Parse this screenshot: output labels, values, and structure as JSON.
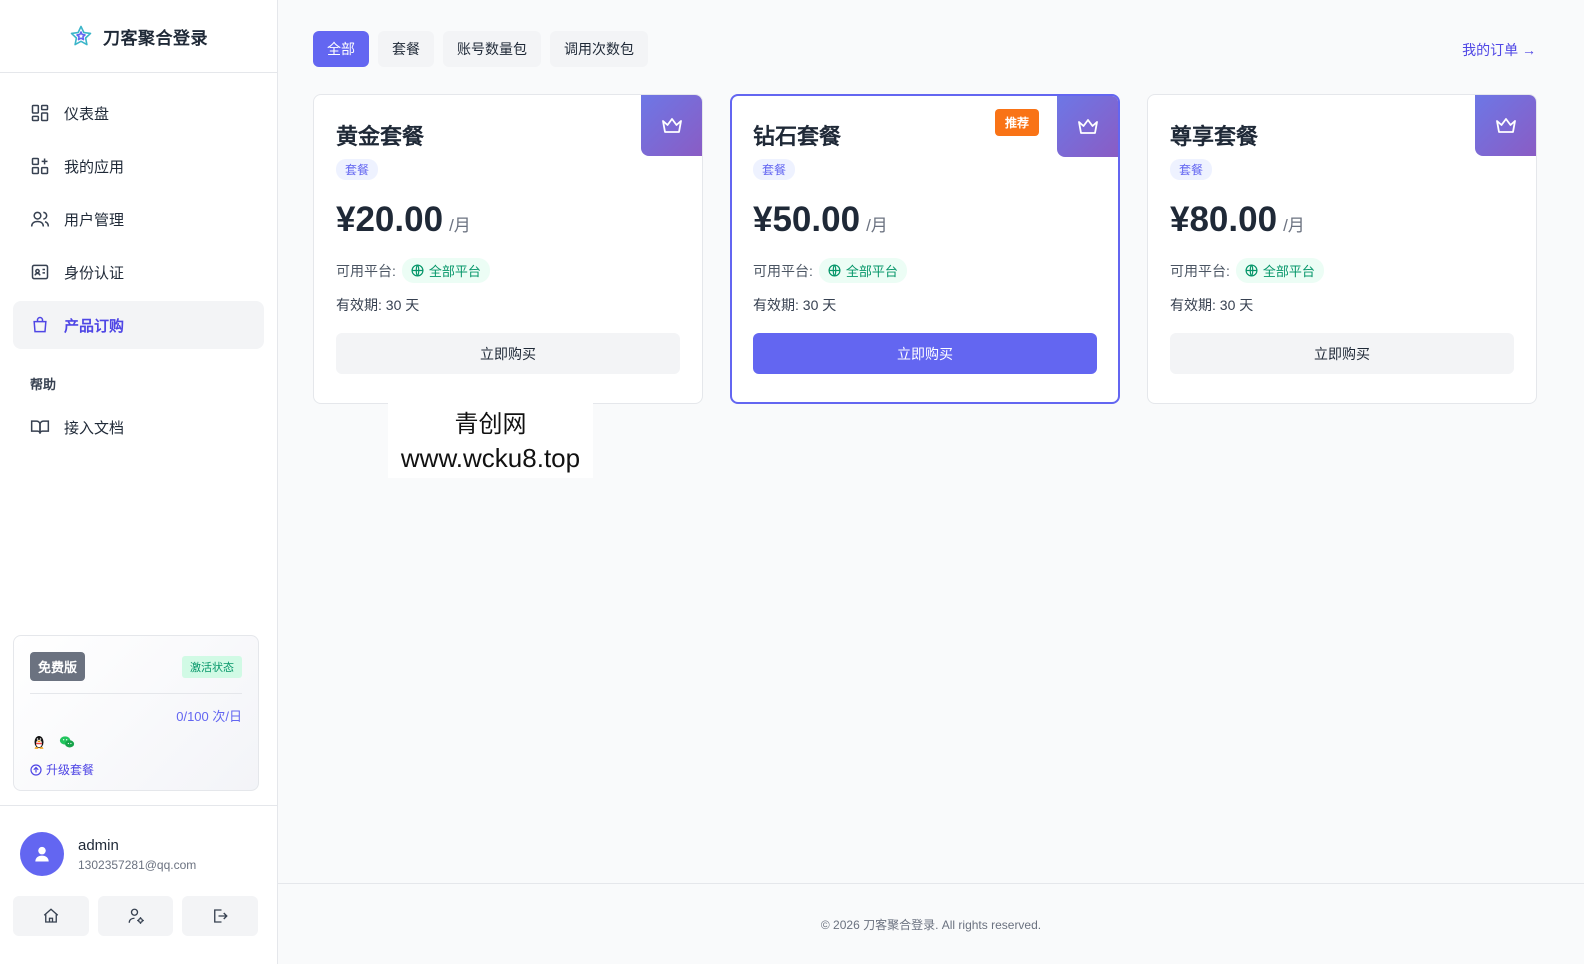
{
  "brand": {
    "title": "刀客聚合登录"
  },
  "sidebar": {
    "items": [
      {
        "label": "仪表盘"
      },
      {
        "label": "我的应用"
      },
      {
        "label": "用户管理"
      },
      {
        "label": "身份认证"
      },
      {
        "label": "产品订购"
      }
    ],
    "section_help": "帮助",
    "help_items": [
      {
        "label": "接入文档"
      }
    ]
  },
  "plan": {
    "badge": "免费版",
    "status": "激活状态",
    "usage": "0/100 次/日",
    "upgrade": "升级套餐"
  },
  "user": {
    "name": "admin",
    "email": "1302357281@qq.com"
  },
  "tabs": [
    {
      "label": "全部"
    },
    {
      "label": "套餐"
    },
    {
      "label": "账号数量包"
    },
    {
      "label": "调用次数包"
    }
  ],
  "orders_link": "我的订单 →",
  "cards": [
    {
      "title": "黄金套餐",
      "tag": "套餐",
      "price": "¥20.00",
      "period": "/月",
      "platform_label": "可用平台:",
      "platform": "全部平台",
      "validity": "有效期: 30 天",
      "button": "立即购买"
    },
    {
      "title": "钻石套餐",
      "tag": "套餐",
      "price": "¥50.00",
      "period": "/月",
      "platform_label": "可用平台:",
      "platform": "全部平台",
      "validity": "有效期: 30 天",
      "button": "立即购买",
      "badge": "推荐"
    },
    {
      "title": "尊享套餐",
      "tag": "套餐",
      "price": "¥80.00",
      "period": "/月",
      "platform_label": "可用平台:",
      "platform": "全部平台",
      "validity": "有效期: 30 天",
      "button": "立即购买"
    }
  ],
  "watermark": {
    "line1": "青创网",
    "line2": "www.wcku8.top"
  },
  "footer": "© 2026 刀客聚合登录. All rights reserved.",
  "colors": {
    "accent": "#6366f1",
    "recommend": "#f97316",
    "success": "#059669"
  }
}
